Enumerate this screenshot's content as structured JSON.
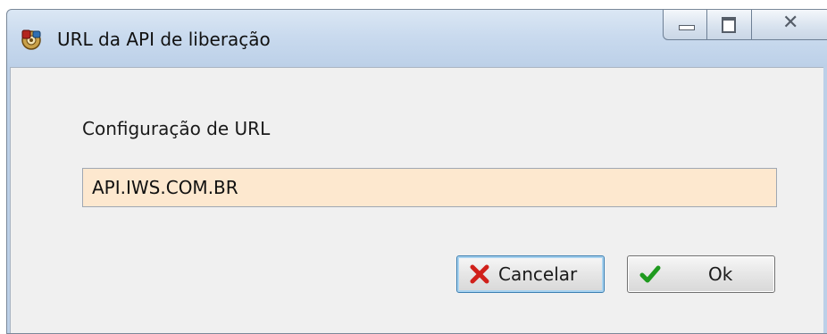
{
  "window": {
    "title": "URL da API de liberação",
    "icon": "app-icon"
  },
  "title_controls": {
    "minimize_icon": "minimize-icon",
    "maximize_icon": "maximize-icon",
    "close_icon": "close-icon"
  },
  "form": {
    "label": "Configuração de URL",
    "url_value": "API.IWS.COM.BR",
    "input_background": "#fde8cf"
  },
  "buttons": {
    "cancel": {
      "label": "Cancelar",
      "icon": "x-icon",
      "icon_color": "#d0201a"
    },
    "ok": {
      "label": "Ok",
      "icon": "check-icon",
      "icon_color": "#1f9a1f"
    }
  }
}
